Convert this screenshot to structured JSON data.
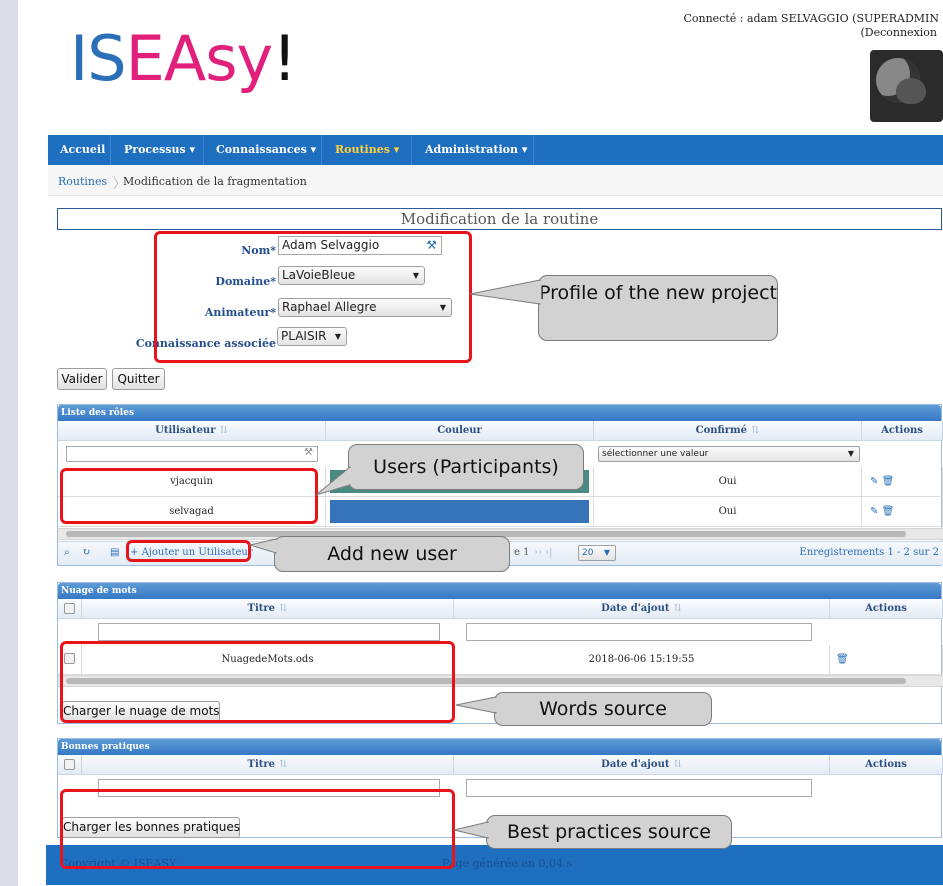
{
  "app": {
    "logo_part1": "IS",
    "logo_part2": "EAsy",
    "logo_part3": "!"
  },
  "header": {
    "connected": "Connecté : adam SELVAGGIO (SUPERADMIN",
    "logout": "(Deconnexion"
  },
  "menu": [
    {
      "label": "Accueil"
    },
    {
      "label": "Processus ▾"
    },
    {
      "label": "Connaissances ▾"
    },
    {
      "label": "Routines ▾"
    },
    {
      "label": "Administration ▾"
    }
  ],
  "breadcrumb": {
    "root": "Routines",
    "current": "Modification de la fragmentation"
  },
  "form": {
    "title": "Modification de la routine",
    "nom_label": "Nom*",
    "nom_value": "Adam Selvaggio",
    "domaine_label": "Domaine*",
    "domaine_value": "LaVoieBleue",
    "animateur_label": "Animateur*",
    "animateur_value": "Raphael Allegre",
    "connaissance_label": "Connaissance associée",
    "connaissance_value": "PLAISIR",
    "valider": "Valider",
    "quitter": "Quitter"
  },
  "roles": {
    "title": "Liste des rôles",
    "columns": [
      "Utilisateur",
      "Couleur",
      "Confirmé",
      "Actions"
    ],
    "confirm_filter": "sélectionner une valeur",
    "rows": [
      {
        "user": "vjacquin",
        "color": "#4a8a82",
        "confirmed": "Oui"
      },
      {
        "user": "selvagad",
        "color": "#3574b8",
        "confirmed": "Oui"
      }
    ],
    "add_user": "Ajouter un Utilisateur",
    "page_text": "e 1",
    "page_size": "20",
    "records": "Enregistrements 1 - 2 sur 2"
  },
  "words": {
    "title": "Nuage de mots",
    "columns": [
      "Titre",
      "Date d'ajout",
      "Actions"
    ],
    "rows": [
      {
        "title": "NuagedeMots.ods",
        "date": "2018-06-06 15:19:55"
      }
    ],
    "load_button": "Charger le nuage de mots"
  },
  "practices": {
    "title": "Bonnes pratiques",
    "columns": [
      "Titre",
      "Date d'ajout",
      "Actions"
    ],
    "load_button": "Charger les bonnes pratiques"
  },
  "footer": {
    "copyright": "Copyright © ISEASY",
    "generated": "Page générée en 0,04 s"
  },
  "annotations": {
    "profile": "Profile of the new project",
    "users": "Users (Participants)",
    "add_user": "Add new user",
    "words": "Words source",
    "practices": "Best practices source"
  },
  "colors": {
    "brand_blue": "#1f6fc1",
    "logo_pink": "#e0207a",
    "annotation_red": "#e8141c"
  }
}
